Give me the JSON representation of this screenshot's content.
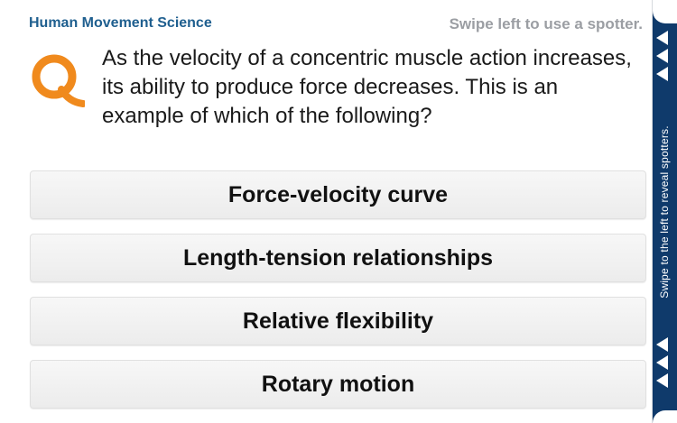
{
  "header": {
    "category": "Human Movement Science",
    "swipe_hint": "Swipe left to use a spotter."
  },
  "question": {
    "icon": "q-logo-icon",
    "text": "As the velocity of a concentric muscle action increases, its ability to produce force decreases. This is an example of which of the following?"
  },
  "answers": [
    {
      "label": "Force-velocity curve"
    },
    {
      "label": "Length-tension relationships"
    },
    {
      "label": "Relative flexibility"
    },
    {
      "label": "Rotary motion"
    }
  ],
  "side_panel": {
    "text": "Swipe to the left to reveal spotters.",
    "icon": "left-arrow-icon"
  },
  "colors": {
    "category": "#1f5f8f",
    "hint": "#9b9ea3",
    "accent_orange": "#f08a1d",
    "side_panel": "#0f3a6b"
  }
}
